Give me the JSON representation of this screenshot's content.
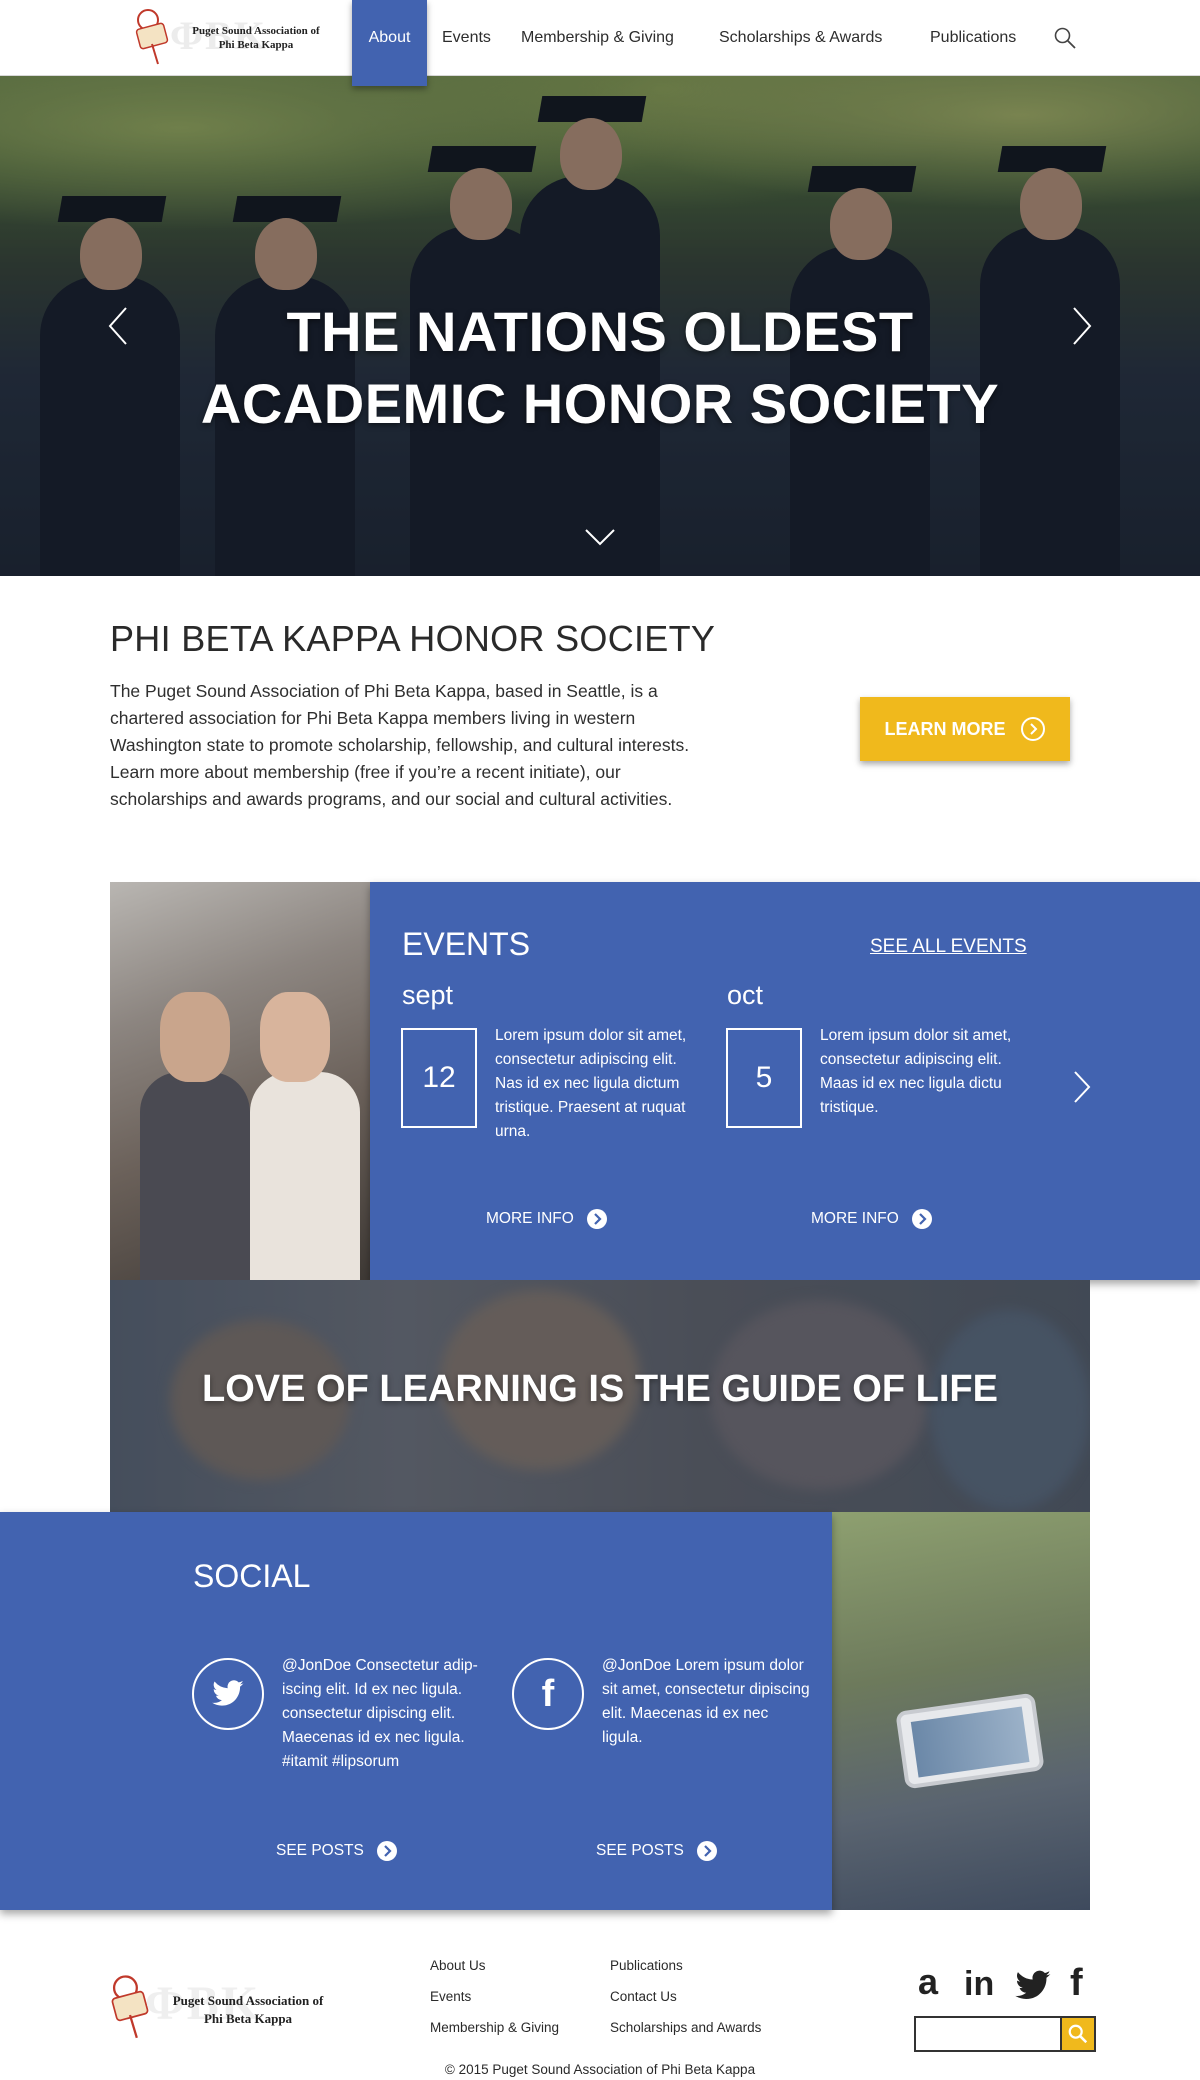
{
  "logo": {
    "line1": "Puget Sound Association of",
    "line2": "Phi Beta Kappa",
    "mark": "ΦBK"
  },
  "nav": {
    "items": [
      {
        "label": "About",
        "active": true
      },
      {
        "label": "Events"
      },
      {
        "label": "Membership & Giving"
      },
      {
        "label": "Scholarships & Awards"
      },
      {
        "label": "Publications"
      }
    ],
    "search_icon": "search-icon"
  },
  "hero": {
    "title_line1": "THE NATIONS OLDEST",
    "title_line2": "ACADEMIC HONOR SOCIETY",
    "icons": [
      "chevron-left-icon",
      "chevron-right-icon",
      "chevron-down-icon"
    ]
  },
  "intro": {
    "title": "PHI BETA KAPPA HONOR SOCIETY",
    "text": "The Puget Sound Association of Phi Beta Kappa, based in Seattle, is a chartered association for Phi Beta Kappa members living in western Washington state to promote scholarship, fellowship, and cultural interests. Learn more about  membership (free if you’re a recent initiate), our scholarships and awards programs, and our social and cultural activities.",
    "button": "LEARN MORE"
  },
  "events": {
    "title": "EVENTS",
    "see_all": "SEE ALL EVENTS",
    "items": [
      {
        "month": "sept",
        "day": "12",
        "desc": "Lorem ipsum dolor sit amet, consectetur adipiscing elit. Nas id ex nec ligula dictum tristique. Praesent at ruquat urna.",
        "more": "MORE INFO"
      },
      {
        "month": "oct",
        "day": "5",
        "desc": "Lorem ipsum dolor sit amet, consectetur adipiscing elit. Maas id ex nec ligula dictu tristique.",
        "more": "MORE INFO"
      }
    ]
  },
  "quote": {
    "text": "LOVE OF LEARNING IS THE GUIDE OF LIFE"
  },
  "social": {
    "title": "SOCIAL",
    "items": [
      {
        "icon": "twitter-icon",
        "text": "@JonDoe Consectetur adip- iscing elit. Id ex nec ligula. consectetur dipiscing elit. Maecenas id ex nec ligula. #itamit #lipsorum",
        "more": "SEE POSTS"
      },
      {
        "icon": "facebook-icon",
        "text": "@JonDoe Lorem ipsum dolor sit amet, consectetur dipiscing elit. Maecenas id ex nec ligula.",
        "more": "SEE POSTS"
      }
    ]
  },
  "footer": {
    "links_col1": [
      "About Us",
      "Events",
      "Membership & Giving"
    ],
    "links_col2": [
      "Publications",
      "Contact Us",
      "Scholarships and Awards"
    ],
    "social_icons": [
      "amazon-icon",
      "linkedin-icon",
      "twitter-icon",
      "facebook-icon"
    ],
    "social_glyphs": [
      "a",
      "in",
      "f"
    ],
    "search_value": "",
    "copyright": "© 2015 Puget Sound Association of Phi Beta Kappa"
  },
  "colors": {
    "brand_blue": "#4263b0",
    "accent_yellow": "#f0b91c"
  }
}
